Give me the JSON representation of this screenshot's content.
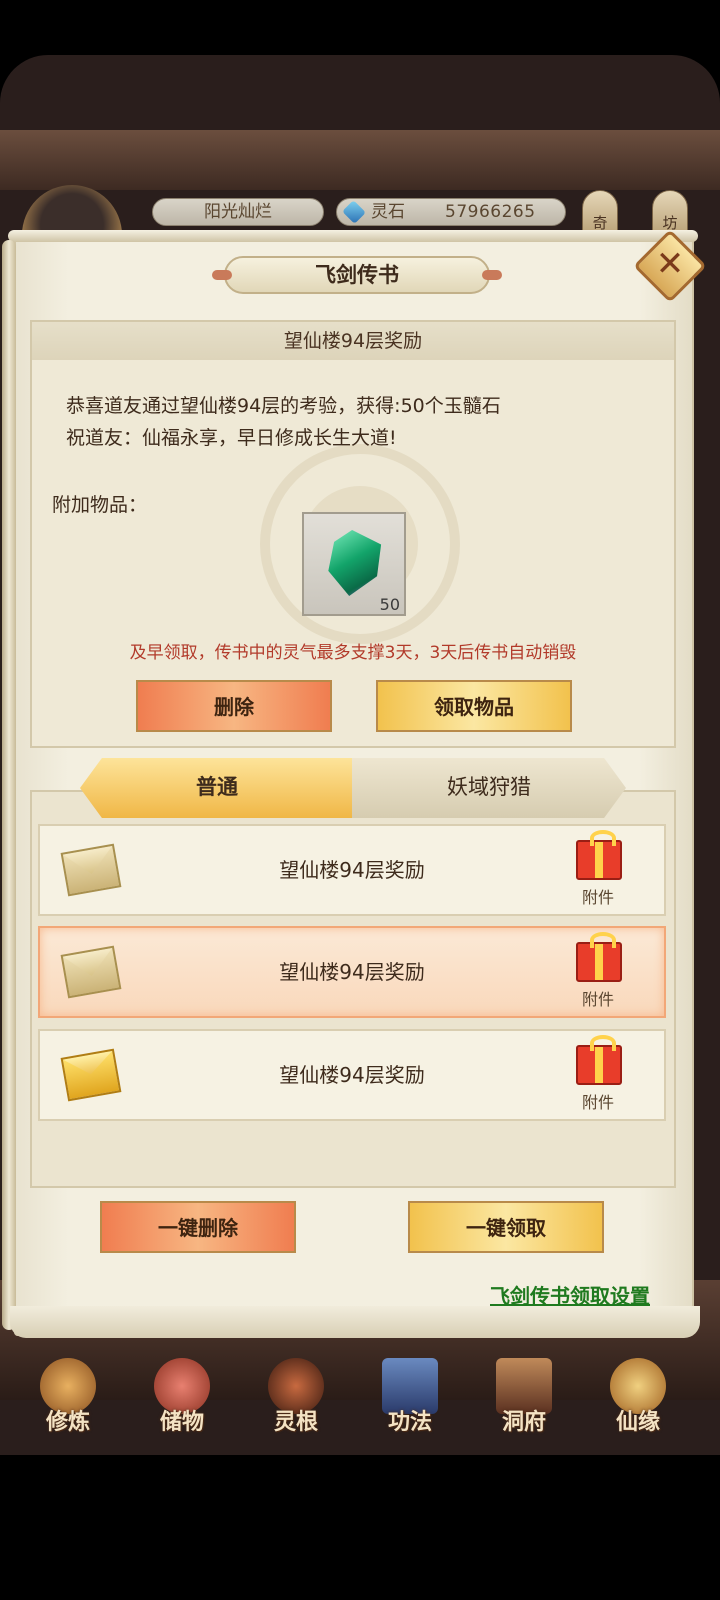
{
  "hud": {
    "player_name": "阳光灿烂",
    "resource_label": "灵石",
    "resource_value": "57966265",
    "side_buttons": [
      "奇",
      "坊"
    ]
  },
  "dialog": {
    "title": "飞剑传书",
    "mail_subject": "望仙楼94层奖励",
    "body_line1": "恭喜道友通过望仙楼94层的考验，获得:50个玉髓石",
    "body_line2": "祝道友：仙福永享，早日修成长生大道!",
    "attachments_label": "附加物品：",
    "item": {
      "icon": "jade-stone-icon",
      "count": "50"
    },
    "warning": "及早领取，传书中的灵气最多支撑3天，3天后传书自动销毁",
    "delete_label": "删除",
    "claim_label": "领取物品"
  },
  "tabs": [
    {
      "label": "普通",
      "active": true
    },
    {
      "label": "妖域狩猎",
      "active": false
    }
  ],
  "mail_list": [
    {
      "title": "望仙楼94层奖励",
      "attachment_label": "附件",
      "state": "opened",
      "selected": false
    },
    {
      "title": "望仙楼94层奖励",
      "attachment_label": "附件",
      "state": "opened",
      "selected": true
    },
    {
      "title": "望仙楼94层奖励",
      "attachment_label": "附件",
      "state": "unread",
      "selected": false
    }
  ],
  "actions": {
    "delete_all": "一键删除",
    "claim_all": "一键领取",
    "settings_link": "飞剑传书领取设置"
  },
  "nav": [
    {
      "label": "修炼",
      "icon": "cultivate-icon",
      "color": "#c98a3a"
    },
    {
      "label": "储物",
      "icon": "storage-bag-icon",
      "color": "#c65a4a"
    },
    {
      "label": "灵根",
      "icon": "spirit-root-icon",
      "color": "#8a3a2a"
    },
    {
      "label": "功法",
      "icon": "technique-book-icon",
      "color": "#3a5a8a"
    },
    {
      "label": "洞府",
      "icon": "cave-dwelling-icon",
      "color": "#8a5a3a"
    },
    {
      "label": "仙缘",
      "icon": "immortal-fate-icon",
      "color": "#d4a050"
    }
  ]
}
